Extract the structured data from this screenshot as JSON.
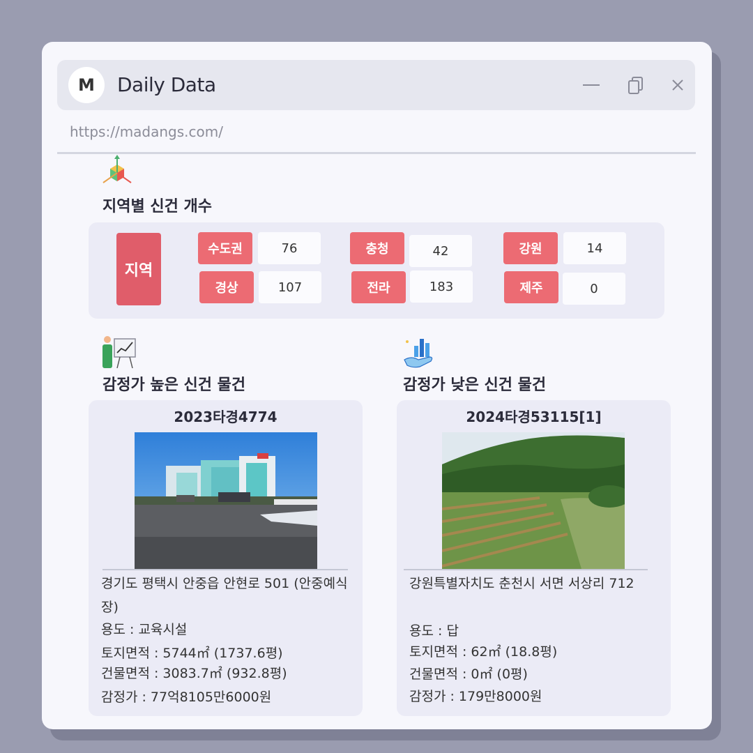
{
  "app": {
    "logo_letter": "M",
    "title": "Daily Data",
    "url": "https://madangs.com/"
  },
  "icons": {
    "minimize": "minimize-icon",
    "restore": "copy-window-icon",
    "close": "close-icon",
    "region_section": "3d-axes-cube-icon",
    "high_section": "presentation-chart-icon",
    "low_section": "hand-bar-chart-icon"
  },
  "region_section": {
    "title": "지역별 신건 개수",
    "label": "지역",
    "regions": [
      {
        "name": "수도권",
        "count": "76"
      },
      {
        "name": "경상",
        "count": "107"
      },
      {
        "name": "충청",
        "count": "42"
      },
      {
        "name": "전라",
        "count": "183"
      },
      {
        "name": "강원",
        "count": "14"
      },
      {
        "name": "제주",
        "count": "0"
      }
    ]
  },
  "high_section": {
    "title": "감정가 높은 신건 물건",
    "case_no": "2023타경4774",
    "address": "경기도 평택시 안중읍 안현로 501 (안중예식장)",
    "usage": "용도 : 교육시설",
    "land_area": "토지면적 : 5744㎡ (1737.6평)",
    "building_area": "건물면적 : 3083.7㎡ (932.8평)",
    "appraisal": "감정가 : 77억8105만6000원"
  },
  "low_section": {
    "title": "감정가 낮은 신건 물건",
    "case_no": "2024타경53115[1]",
    "address": "강원특별자치도 춘천시 서면 서상리 712",
    "usage": "용도 :  답",
    "land_area": "토지면적 : 62㎡ (18.8평)",
    "building_area": "건물면적 : 0㎡ (0평)",
    "appraisal": "감정가 : 179만8000원"
  },
  "colors": {
    "tag": "#ec6b73",
    "label": "#e05d6a",
    "card": "#ebebf6",
    "background": "#9a9cb0"
  }
}
